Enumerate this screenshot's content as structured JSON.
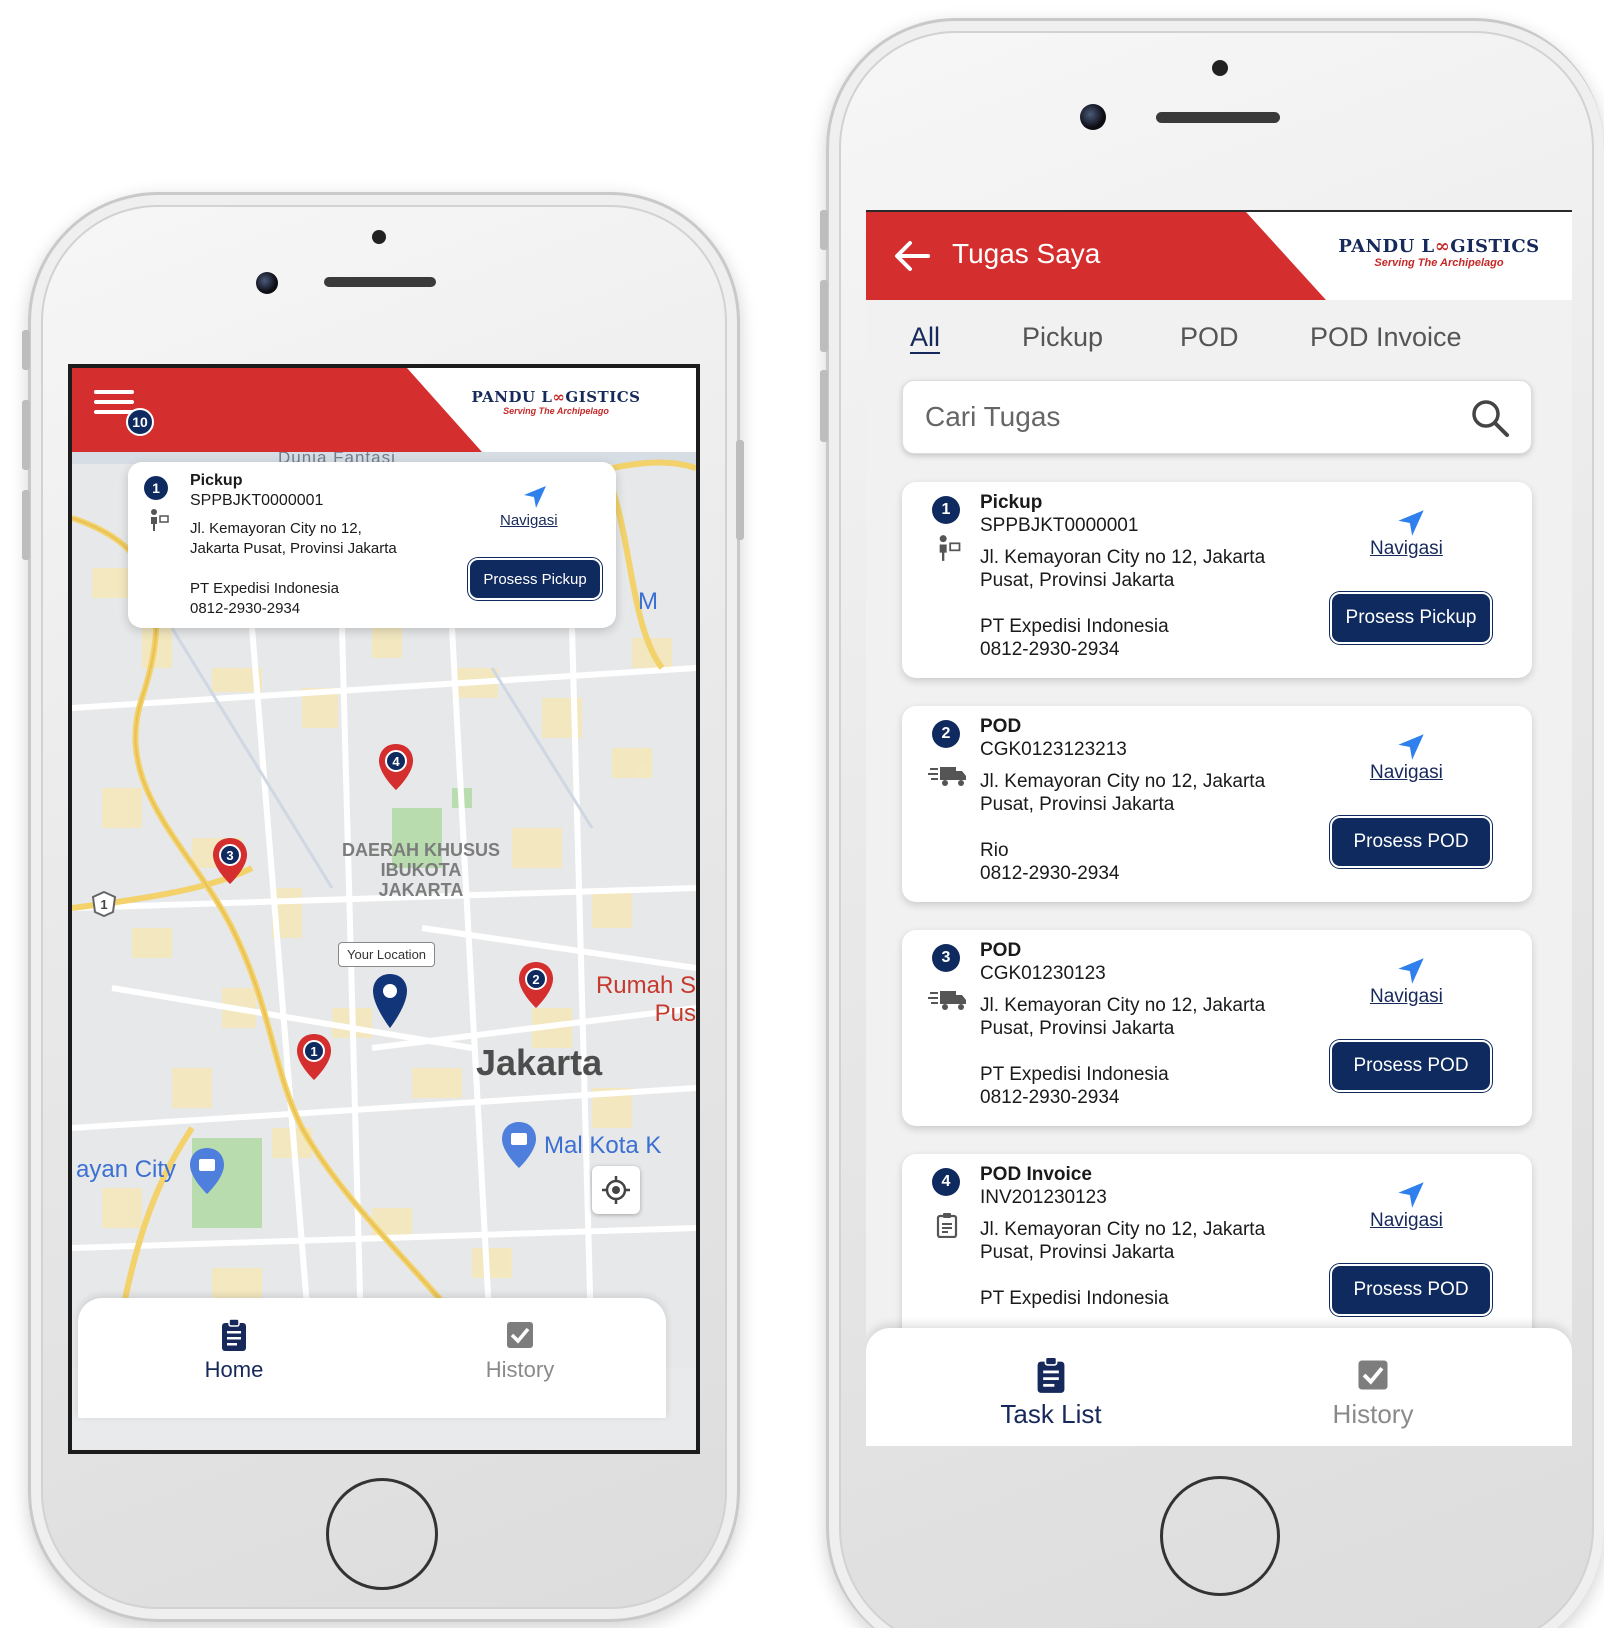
{
  "brand": {
    "name_part1": "PANDU L",
    "name_part2": "GISTICS",
    "tagline": "Serving The Archipelago",
    "red": "#d42e2e",
    "navy": "#0f2a5e"
  },
  "home_screen": {
    "menu_badge": "10",
    "popup": {
      "number": "1",
      "type": "Pickup",
      "code": "SPPBJKT0000001",
      "address_line1": "Jl. Kemayoran City no 12,",
      "address_line2": "Jakarta Pusat, Provinsi Jakarta",
      "company": "PT Expedisi Indonesia",
      "phone": "0812-2930-2934",
      "nav_label": "Navigasi",
      "action_label": "Prosess Pickup"
    },
    "map": {
      "region_line1": "DAERAH KHUSUS",
      "region_line2": "IBUKOTA",
      "region_line3": "JAKARTA",
      "city_label": "Jakarta",
      "poi_hospital_1": "Rumah S",
      "poi_hospital_2": "Pus",
      "poi_mall": "Mal Kota K",
      "poi_city": "ayan City",
      "poi_top_partial": "M",
      "poi_dunia": "Dunia Fantasi",
      "your_location": "Your Location",
      "road_marker": "1",
      "pins": [
        "1",
        "2",
        "3",
        "4"
      ]
    },
    "bottom_nav": {
      "home": "Home",
      "history": "History"
    }
  },
  "task_screen": {
    "title": "Tugas Saya",
    "tabs": [
      "All",
      "Pickup",
      "POD",
      "POD Invoice"
    ],
    "search_placeholder": "Cari Tugas",
    "tasks": [
      {
        "number": "1",
        "type": "Pickup",
        "code": "SPPBJKT0000001",
        "address_line1": "Jl. Kemayoran City no 12, Jakarta",
        "address_line2": "Pusat, Provinsi Jakarta",
        "contact": "PT Expedisi Indonesia",
        "phone": "0812-2930-2934",
        "nav_label": "Navigasi",
        "action_label": "Prosess Pickup",
        "icon": "pickup-person-icon"
      },
      {
        "number": "2",
        "type": "POD",
        "code": "CGK0123123213",
        "address_line1": "Jl. Kemayoran City no 12, Jakarta",
        "address_line2": "Pusat, Provinsi Jakarta",
        "contact": "Rio",
        "phone": "0812-2930-2934",
        "nav_label": "Navigasi",
        "action_label": "Prosess POD",
        "icon": "delivery-truck-icon"
      },
      {
        "number": "3",
        "type": "POD",
        "code": "CGK01230123",
        "address_line1": "Jl. Kemayoran City no 12, Jakarta",
        "address_line2": "Pusat, Provinsi Jakarta",
        "contact": "PT Expedisi Indonesia",
        "phone": "0812-2930-2934",
        "nav_label": "Navigasi",
        "action_label": "Prosess POD",
        "icon": "delivery-truck-icon"
      },
      {
        "number": "4",
        "type": "POD Invoice",
        "code": "INV201230123",
        "address_line1": "Jl. Kemayoran City no 12, Jakarta",
        "address_line2": "Pusat, Provinsi Jakarta",
        "contact": "PT Expedisi Indonesia",
        "phone": "",
        "nav_label": "Navigasi",
        "action_label": "Prosess POD",
        "icon": "invoice-clipboard-icon"
      }
    ],
    "bottom_nav": {
      "task_list": "Task List",
      "history": "History"
    }
  }
}
